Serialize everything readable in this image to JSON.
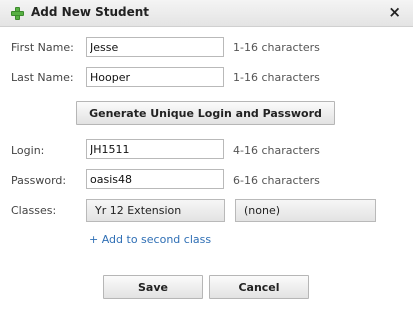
{
  "dialog": {
    "title": "Add New Student",
    "close_glyph": "×",
    "title_icon": "plus-icon",
    "close_icon": "close-icon"
  },
  "form": {
    "first_name": {
      "label": "First Name:",
      "value": "Jesse",
      "hint": "1-16 characters"
    },
    "last_name": {
      "label": "Last Name:",
      "value": "Hooper",
      "hint": "1-16 characters"
    },
    "generate_button": "Generate Unique Login and Password",
    "login": {
      "label": "Login:",
      "value": "JH1511",
      "hint": "4-16 characters"
    },
    "password": {
      "label": "Password:",
      "value": "oasis48",
      "hint": "6-16 characters"
    },
    "classes": {
      "label": "Classes:",
      "first_class": "Yr 12 Extension",
      "second_class": "(none)",
      "add_link": "+ Add to second class"
    }
  },
  "actions": {
    "save": "Save",
    "cancel": "Cancel"
  },
  "colors": {
    "accent_green": "#57b043",
    "link_blue": "#2f6fb5"
  }
}
